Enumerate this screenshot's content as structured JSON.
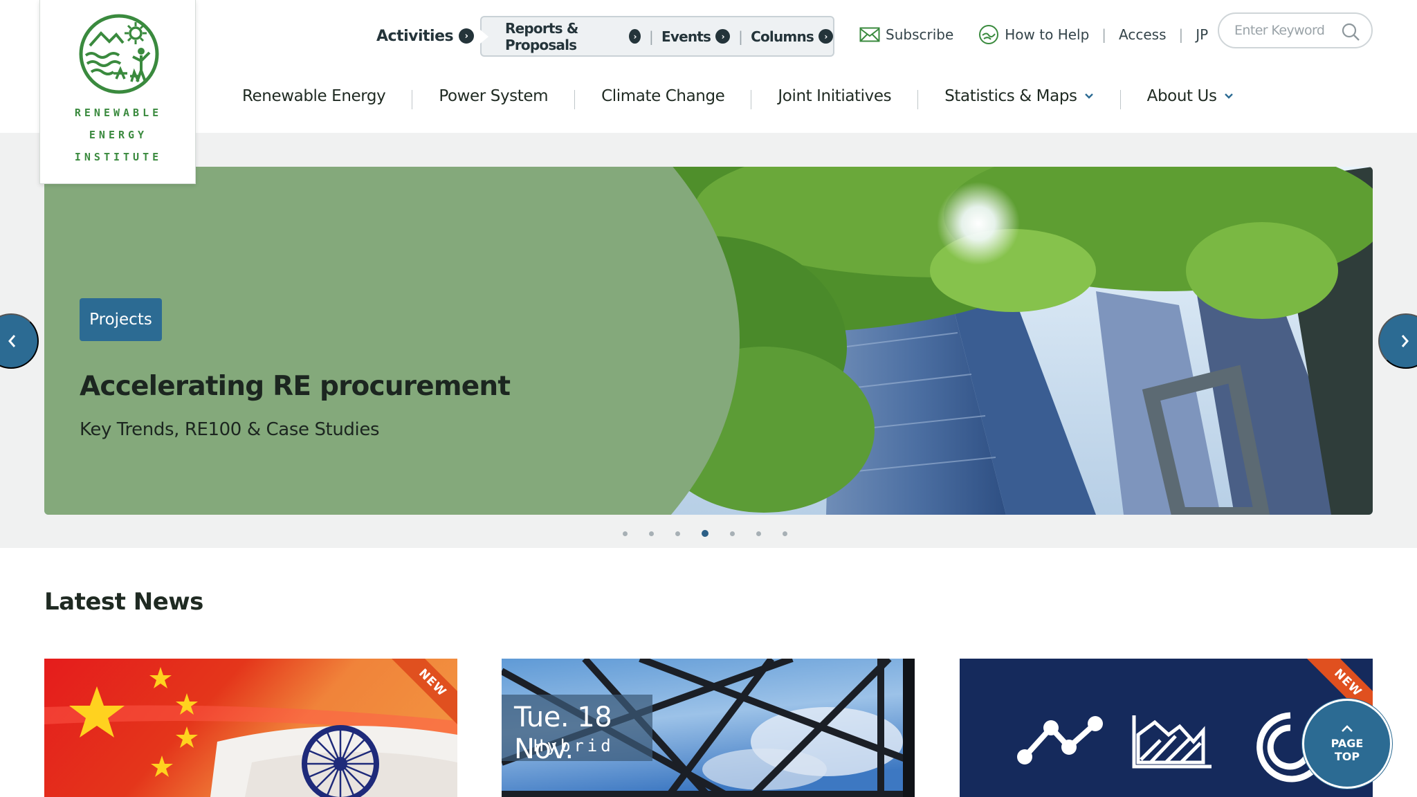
{
  "logo": {
    "line1": "RENEWABLE",
    "line2": "ENERGY",
    "line3": "INSTITUTE",
    "color": "#3a8a3e"
  },
  "utility_nav": {
    "activities": "Activities",
    "sub_items": [
      {
        "label": "Reports & Proposals"
      },
      {
        "label": "Events"
      },
      {
        "label": "Columns"
      }
    ],
    "subscribe": "Subscribe",
    "how_to_help": "How to Help",
    "access": "Access",
    "language": "JP"
  },
  "search": {
    "placeholder": "Enter Keyword"
  },
  "main_nav": {
    "items": [
      {
        "label": "Renewable Energy"
      },
      {
        "label": "Power System"
      },
      {
        "label": "Climate Change"
      },
      {
        "label": "Joint Initiatives"
      },
      {
        "label": "Statistics & Maps"
      },
      {
        "label": "About Us"
      }
    ]
  },
  "hero": {
    "tag": "Projects",
    "title": "Accelerating RE procurement",
    "subtitle": "Key Trends, RE100 & Case Studies",
    "slide_count": 7,
    "active_slide": 4
  },
  "news": {
    "heading": "Latest News",
    "cards": [
      {
        "badge": "NEW"
      },
      {
        "date": "Tue. 18 Nov.",
        "type": "Hybrid"
      },
      {
        "badge": "NEW"
      }
    ]
  },
  "page_top": {
    "line1": "PAGE",
    "line2": "TOP"
  },
  "colors": {
    "accent": "#2c6b93",
    "hero_green": "#84a97b",
    "new_badge": "#e0501f",
    "dark_navy": "#152a5c"
  }
}
